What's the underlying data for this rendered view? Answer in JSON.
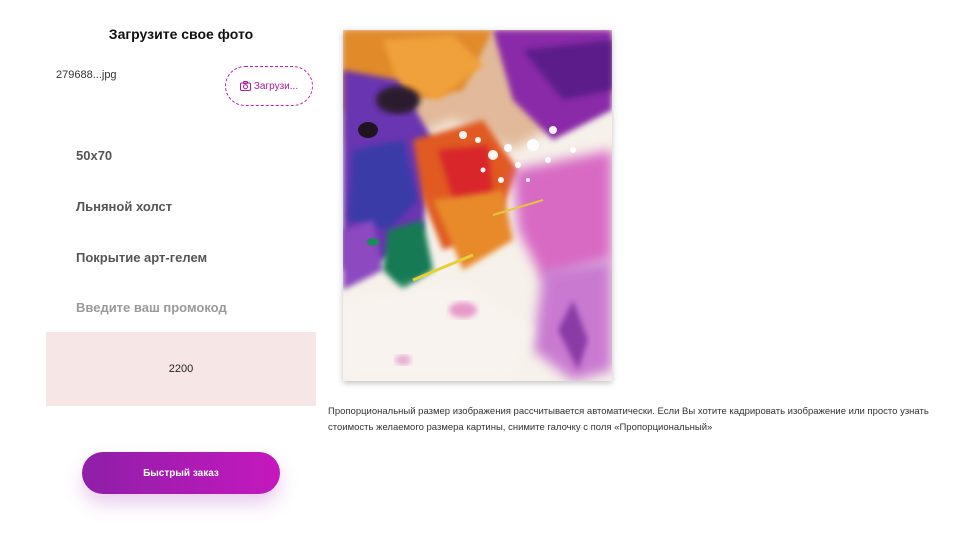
{
  "upload": {
    "title": "Загрузите свое фото",
    "file_name": "279688...jpg",
    "button_label": "Загрузи..."
  },
  "options": {
    "size": "50x70",
    "material": "Льняной холст",
    "coating": "Покрытие арт-гелем",
    "promo_placeholder": "Введите ваш промокод"
  },
  "price": "2200",
  "quick_order_label": "Быстрый заказ",
  "note": "Пропорциональный размер изображения рассчитывается автоматически. Если Вы хотите кадрировать изображение или просто узнать стоимость желаемого размера картины, снимите галочку с поля «Пропорциональный»",
  "colors": {
    "accent": "#c21ab2",
    "button_gradient_start": "#8e1fa8",
    "button_gradient_end": "#c518be",
    "price_background": "#f6e6e6"
  }
}
